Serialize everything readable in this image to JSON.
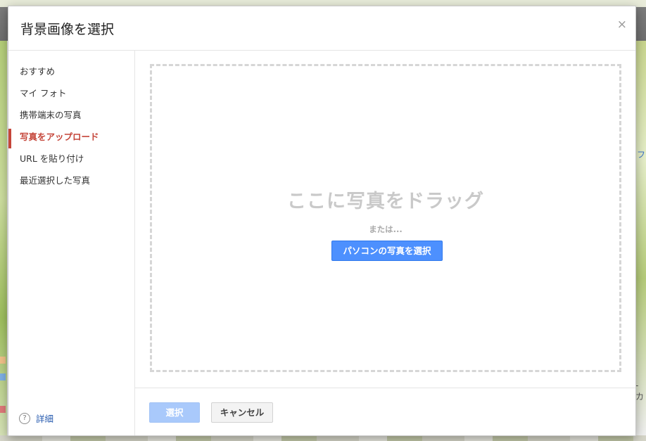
{
  "dialog": {
    "title": "背景画像を選択",
    "close_label": "×"
  },
  "sidebar": {
    "items": [
      {
        "label": "おすすめ",
        "active": false
      },
      {
        "label": "マイ フォト",
        "active": false
      },
      {
        "label": "携帯端末の写真",
        "active": false
      },
      {
        "label": "写真をアップロード",
        "active": true
      },
      {
        "label": "URL を貼り付け",
        "active": false
      },
      {
        "label": "最近選択した写真",
        "active": false
      }
    ],
    "help": {
      "icon": "?",
      "label": "詳細"
    }
  },
  "upload": {
    "drop_heading": "ここに写真をドラッグ",
    "or_text": "または...",
    "pick_button": "パソコンの写真を選択"
  },
  "footer": {
    "select_button": "選択",
    "cancel_button": "キャンセル"
  },
  "background": {
    "edge_text_right_1": "フ",
    "edge_text_right_2": "-カ"
  },
  "colors": {
    "accent_active": "#c5463a",
    "primary_button": "#4d90fe",
    "disabled_button": "#a9c9fb",
    "link": "#2a5db0"
  }
}
